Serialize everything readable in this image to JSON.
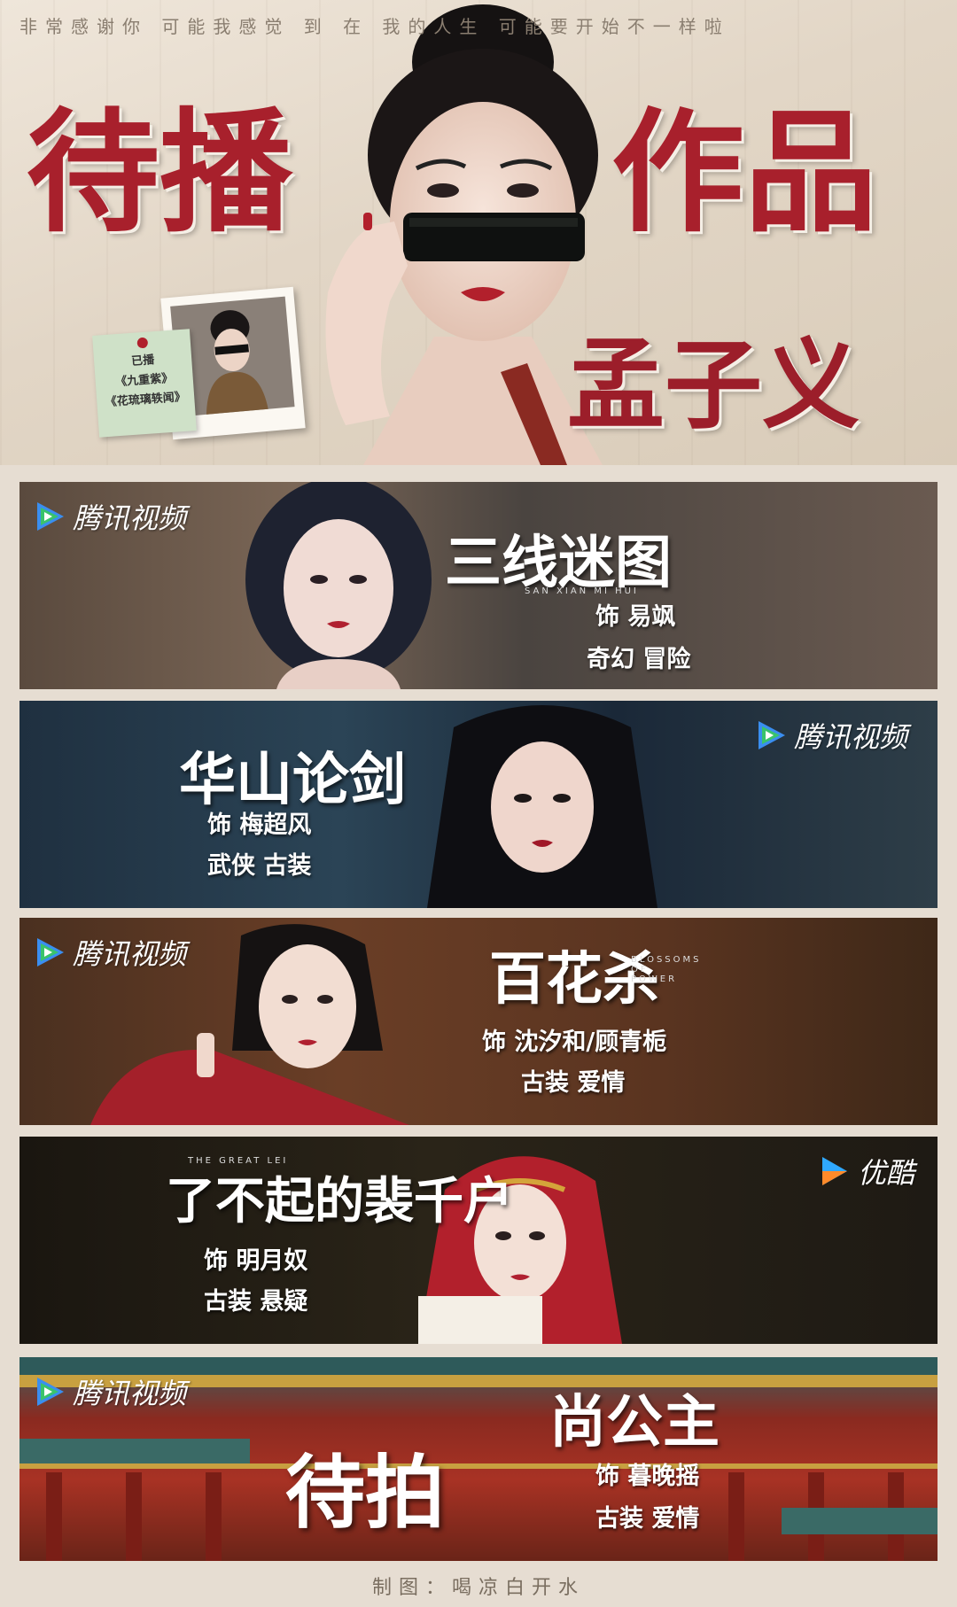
{
  "header": {
    "top_quote": "非常感谢你 可能我感觉 到 在 我的人生 可能要开始不一样啦",
    "title_left": "待播",
    "title_right": "作品",
    "actor_name": "孟子义",
    "sticky_note": {
      "line1": "已播",
      "line2": "《九重紫》",
      "line3": "《花琉璃轶闻》"
    }
  },
  "banners": [
    {
      "platform": "腾讯视频",
      "title": "三线迷图",
      "title_en": "SAN XIAN MI HUI",
      "role": "饰 易飒",
      "genre": "奇幻 冒险"
    },
    {
      "platform": "腾讯视频",
      "title": "华山论剑",
      "role": "饰 梅超风",
      "genre": "武侠 古装"
    },
    {
      "platform": "腾讯视频",
      "title": "百花杀",
      "title_en": "BLOSSOMS OF POWER",
      "role": "饰 沈汐和/顾青栀",
      "genre": "古装 爱情"
    },
    {
      "platform": "优酷",
      "title": "了不起的裴千户",
      "title_en": "THE GREAT LEI",
      "role": "饰 明月奴",
      "genre": "古装 悬疑"
    },
    {
      "platform": "腾讯视频",
      "status": "待拍",
      "title": "尚公主",
      "role": "饰 暮晚摇",
      "genre": "古装 爱情"
    }
  ],
  "credit": "制图：喝凉白开水",
  "colors": {
    "title_red": "#a8202c",
    "tencent_green": "#3ac36b",
    "tencent_blue": "#3a8ef0",
    "youku_blue": "#2fa8ff",
    "youku_orange": "#ff8a2a"
  }
}
